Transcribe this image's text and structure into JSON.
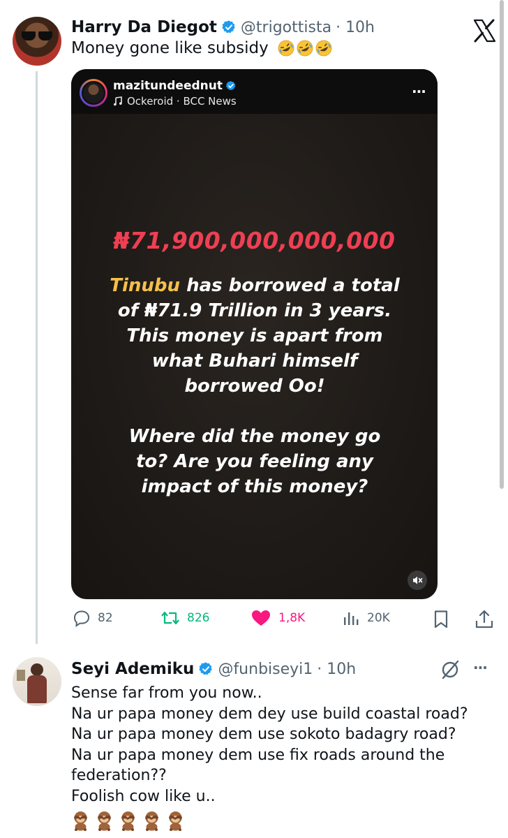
{
  "post": {
    "author_name": "Harry Da Diegot",
    "author_handle": "@trigottista",
    "time": "· 10h",
    "text": "Money gone like subsidy",
    "emoji": [
      "rolling-on-floor-laughing",
      "rolling-on-floor-laughing",
      "rolling-on-floor-laughing"
    ]
  },
  "media": {
    "username": "mazitundeednut",
    "sound": "Ockeroid · BCC News",
    "menu_glyph": "···",
    "amount": "₦71,900,000,000,000",
    "highlight": "Tinubu",
    "line1_rest": " has borrowed a total",
    "line2": "of ₦71.9 Trillion in 3 years.",
    "line3": "This money is apart from",
    "line4": "what Buhari himself",
    "line5": "borrowed Oo!",
    "line6": "Where did the money go",
    "line7": "to? Are you feeling any",
    "line8": "impact of this money?"
  },
  "actions": {
    "replies": "82",
    "reposts": "826",
    "likes": "1,8K",
    "views": "20K",
    "repost_color": "#00ba7c",
    "like_color": "#f91880"
  },
  "reply": {
    "author_name": "Seyi Ademiku",
    "author_handle": "@funbiseyi1",
    "time": "· 10h",
    "more_glyph": "···",
    "lines": [
      "Sense far from you  now..",
      "Na ur papa money dem dey use build coastal road?",
      "Na ur papa money dem use sokoto badagry road?",
      "Na ur papa money dem use fix roads around the",
      "federation??",
      "Foolish cow like u.."
    ],
    "emoji": [
      "see-no-evil-monkey",
      "see-no-evil-monkey",
      "see-no-evil-monkey",
      "see-no-evil-monkey",
      "see-no-evil-monkey"
    ]
  },
  "colors": {
    "verified": "#1d9bf0",
    "amount": "#ee3f53",
    "highlight": "#f5c04a",
    "secondary_text": "#536471"
  }
}
